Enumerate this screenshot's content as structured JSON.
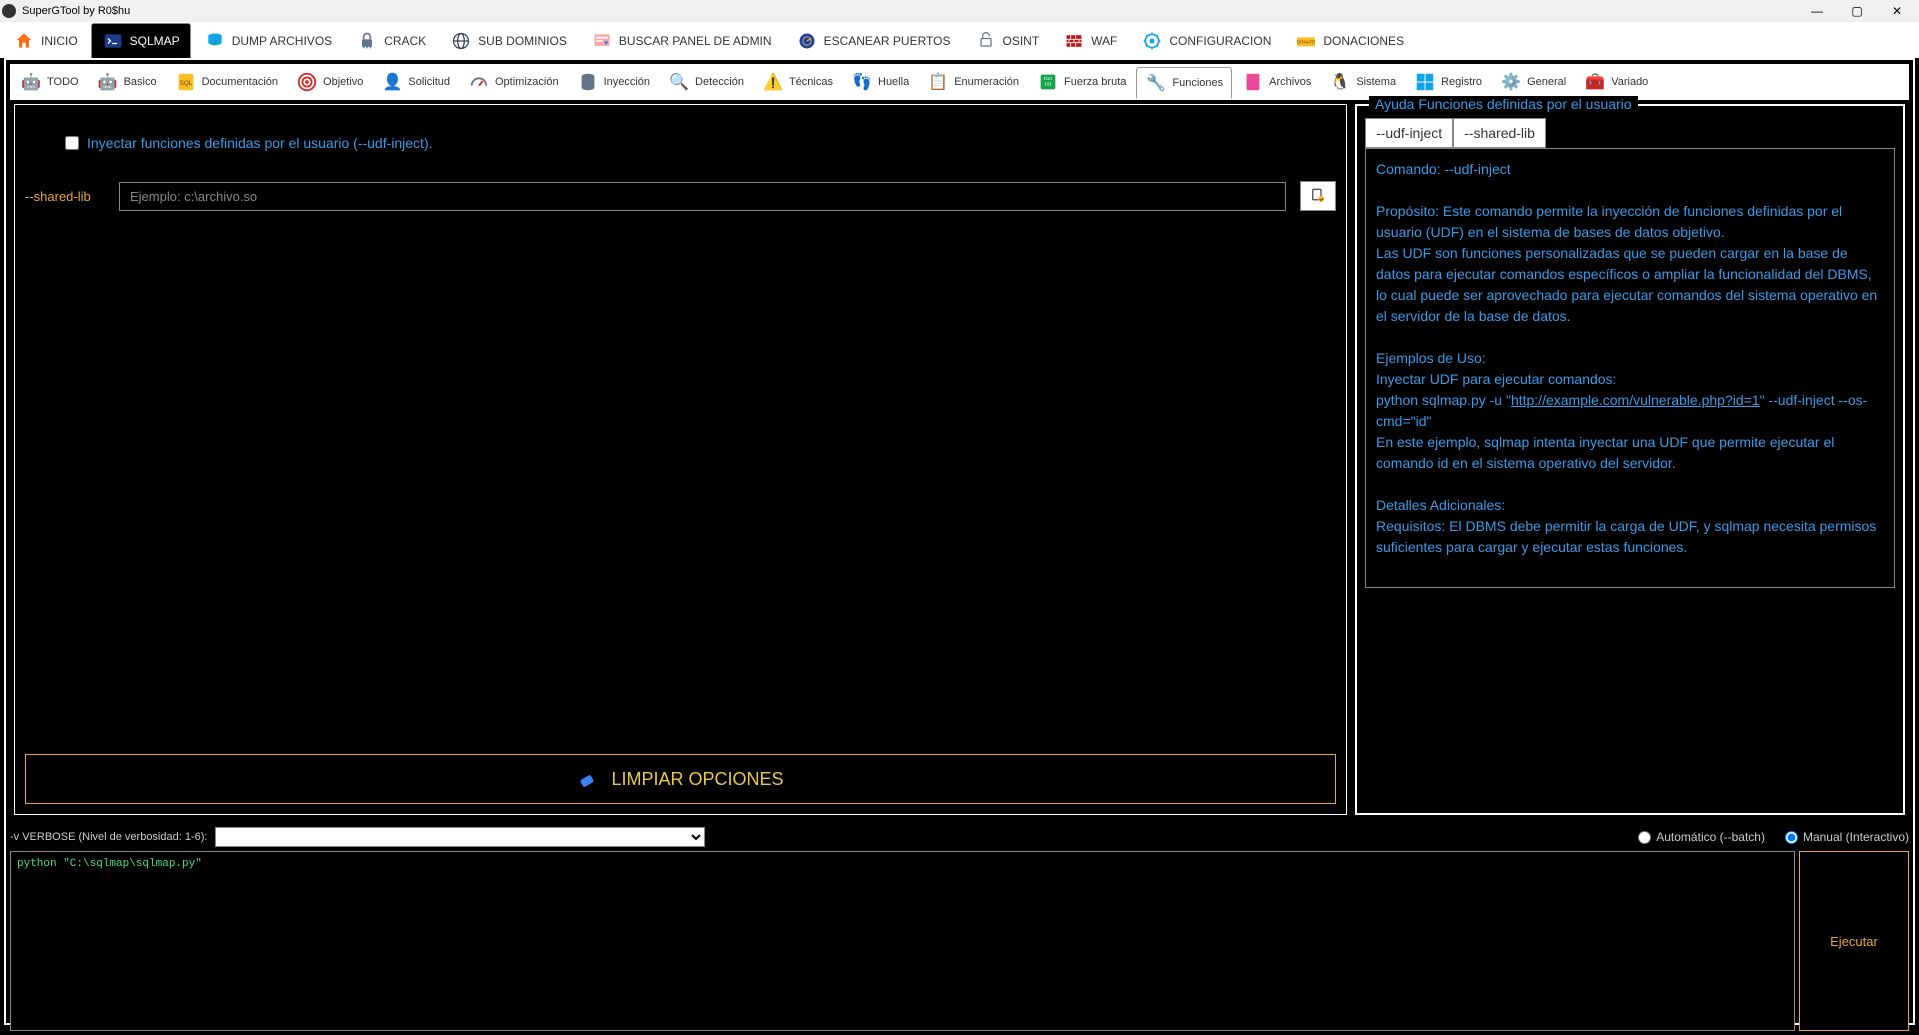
{
  "titlebar": {
    "title": "SuperGTool by R0$hu"
  },
  "main_tabs": [
    {
      "label": "INICIO",
      "icon": "home"
    },
    {
      "label": "SQLMAP",
      "icon": "terminal",
      "active": true
    },
    {
      "label": "DUMP ARCHIVOS",
      "icon": "download"
    },
    {
      "label": "CRACK",
      "icon": "lock"
    },
    {
      "label": "SUB DOMINIOS",
      "icon": "globe"
    },
    {
      "label": "BUSCAR PANEL DE ADMIN",
      "icon": "admin"
    },
    {
      "label": "ESCANEAR PUERTOS",
      "icon": "scan"
    },
    {
      "label": "OSINT",
      "icon": "osint"
    },
    {
      "label": "WAF",
      "icon": "firewall"
    },
    {
      "label": "CONFIGURACION",
      "icon": "gear"
    },
    {
      "label": "DONACIONES",
      "icon": "donate"
    }
  ],
  "sub_tabs": [
    {
      "label": "TODO",
      "icon": "robot"
    },
    {
      "label": "Basico",
      "icon": "bot"
    },
    {
      "label": "Documentación",
      "icon": "sql"
    },
    {
      "label": "Objetivo",
      "icon": "target"
    },
    {
      "label": "Solicitud",
      "icon": "request"
    },
    {
      "label": "Optimización",
      "icon": "gauge"
    },
    {
      "label": "Inyección",
      "icon": "db"
    },
    {
      "label": "Detección",
      "icon": "detect"
    },
    {
      "label": "Técnicas",
      "icon": "tech"
    },
    {
      "label": "Huella",
      "icon": "finger"
    },
    {
      "label": "Enumeración",
      "icon": "enum"
    },
    {
      "label": "Fuerza bruta",
      "icon": "brute"
    },
    {
      "label": "Funciones",
      "icon": "func",
      "active": true
    },
    {
      "label": "Archivos",
      "icon": "files"
    },
    {
      "label": "Sistema",
      "icon": "linux"
    },
    {
      "label": "Registro",
      "icon": "windows"
    },
    {
      "label": "General",
      "icon": "general"
    },
    {
      "label": "Variado",
      "icon": "misc"
    }
  ],
  "options": {
    "udf_inject_label": "Inyectar funciones definidas por el usuario (--udf-inject).",
    "shared_lib_label": "--shared-lib",
    "shared_lib_placeholder": "Ejemplo: c:\\archivo.so",
    "clear_label": "LIMPIAR OPCIONES"
  },
  "help": {
    "legend": "Ayuda Funciones definidas por el usuario",
    "tabs": [
      "--udf-inject",
      "--shared-lib"
    ],
    "command_line": "Comando: --udf-inject",
    "purpose_title": "Propósito: Este comando permite la inyección de funciones definidas por el usuario (UDF) en el sistema de bases de datos objetivo.",
    "purpose_body1": "Las UDF son funciones personalizadas que se pueden cargar en la base de datos para ejecutar comandos específicos o ampliar la funcionalidad del DBMS,",
    "purpose_body2": "lo cual puede ser aprovechado para ejecutar comandos del sistema operativo en el servidor de la base de datos.",
    "examples_title": "Ejemplos de Uso:",
    "example_line1": "Inyectar UDF para ejecutar comandos:",
    "example_cmd_pre": "python sqlmap.py -u \"",
    "example_url": "http://example.com/vulnerable.php?id=1",
    "example_cmd_post": "\" --udf-inject --os-cmd=\"id\"",
    "example_desc": "En este ejemplo, sqlmap intenta inyectar una UDF que permite ejecutar el comando id en el sistema operativo del servidor.",
    "details_title": "Detalles Adicionales:",
    "details_body": "Requisitos: El DBMS debe permitir la carga de UDF, y sqlmap necesita permisos suficientes para cargar y ejecutar estas funciones."
  },
  "bottom": {
    "verbose_label": "-v VERBOSE (Nivel de verbosidad: 1-6):",
    "auto_label": "Automático (--batch)",
    "manual_label": "Manual (Interactivo)",
    "console_text": "python \"C:\\sqlmap\\sqlmap.py\"",
    "exec_label": "Ejecutar"
  }
}
